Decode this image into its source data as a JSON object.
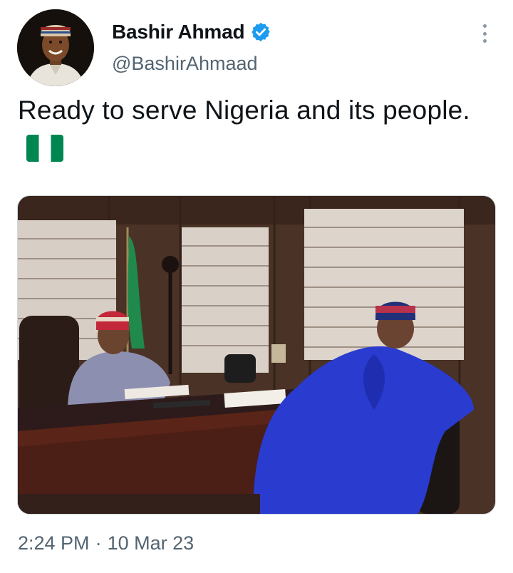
{
  "author": {
    "name": "Bashir Ahmad",
    "handle": "@BashirAhmaad",
    "verified": true,
    "avatar_icon": "profile-photo"
  },
  "tweet": {
    "text": "Ready to serve Nigeria and its people.",
    "emoji": "nigeria-flag-icon",
    "time": "2:24 PM",
    "separator": "·",
    "date": "10 Mar 23"
  },
  "media": {
    "type": "photo"
  },
  "colors": {
    "verified_blue": "#1d9bf0",
    "secondary_text": "#536471",
    "flag_green": "#008751",
    "agbada_blue": "#2a3bd0"
  },
  "icons": {
    "more": "more-options-icon",
    "verified": "verified-badge-icon"
  }
}
